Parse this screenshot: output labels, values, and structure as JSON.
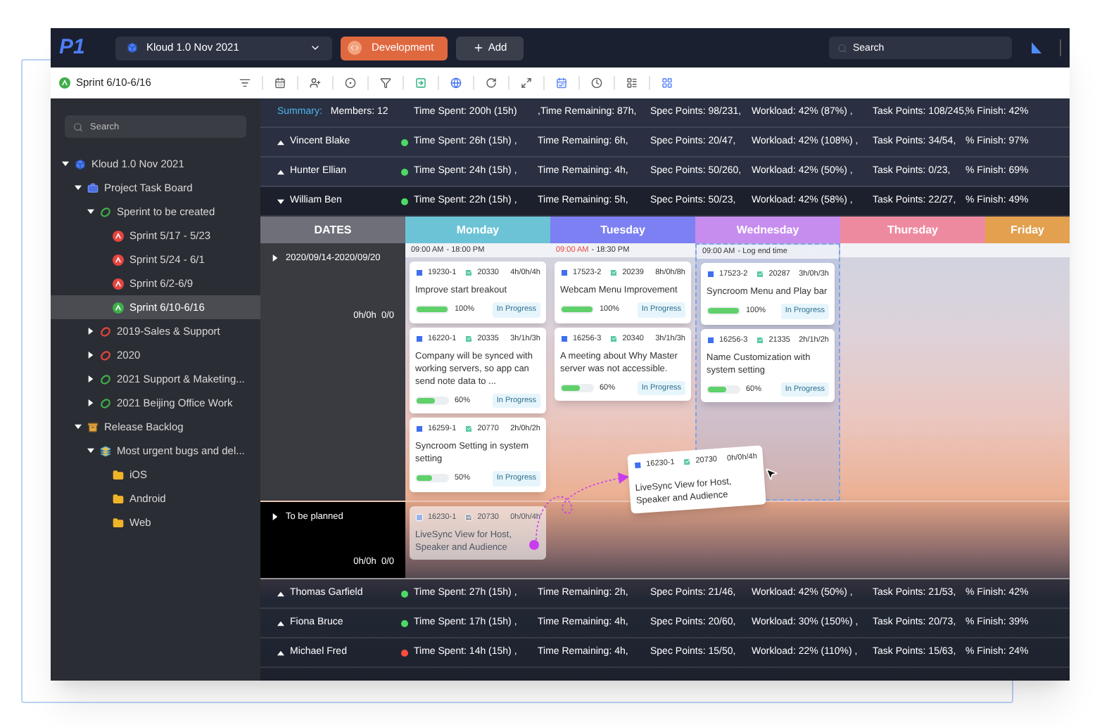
{
  "topbar": {
    "logo": "P1",
    "project": "Kloud 1.0 Nov 2021",
    "mode": "Development",
    "add": "Add",
    "search": {
      "placeholder": "Search"
    }
  },
  "toolbar": {
    "sprint": "Sprint 6/10-6/16"
  },
  "sidebar": {
    "search": {
      "placeholder": "Search"
    },
    "tree": [
      {
        "label": "Kloud 1.0 Nov 2021",
        "kind": "project",
        "expanded": true,
        "selected": false,
        "children": [
          {
            "label": "Project Task Board",
            "kind": "board",
            "expanded": true,
            "selected": false,
            "children": [
              {
                "label": "Sperint to be created",
                "kind": "sprint-group",
                "color": "#3fae49",
                "expanded": true,
                "selected": false,
                "children": [
                  {
                    "label": "Sprint 5/17 - 5/23",
                    "kind": "sprint",
                    "color": "#e5453f",
                    "selected": false
                  },
                  {
                    "label": "Sprint 5/24 - 6/1",
                    "kind": "sprint",
                    "color": "#e5453f",
                    "selected": false
                  },
                  {
                    "label": "Sprint 6/2-6/9",
                    "kind": "sprint",
                    "color": "#e5453f",
                    "selected": false
                  },
                  {
                    "label": "Sprint 6/10-6/16",
                    "kind": "sprint",
                    "color": "#3fae49",
                    "selected": true
                  }
                ]
              },
              {
                "label": "2019-Sales & Support",
                "kind": "sprint-group",
                "color": "#e5453f",
                "expanded": false,
                "selected": false
              },
              {
                "label": "2020",
                "kind": "sprint-group",
                "color": "#e5453f",
                "expanded": false,
                "selected": false
              },
              {
                "label": "2021 Support & Maketing...",
                "kind": "sprint-group",
                "color": "#3fae49",
                "expanded": false,
                "selected": false
              },
              {
                "label": "2021 Beijing Office Work",
                "kind": "sprint-group",
                "color": "#3fae49",
                "expanded": false,
                "selected": false
              }
            ]
          },
          {
            "label": "Release Backlog",
            "kind": "backlog",
            "expanded": true,
            "selected": false,
            "children": [
              {
                "label": "Most urgent bugs and del...",
                "kind": "stack",
                "expanded": true,
                "selected": false,
                "children": [
                  {
                    "label": "iOS",
                    "kind": "folder",
                    "selected": false
                  },
                  {
                    "label": "Android",
                    "kind": "folder",
                    "selected": false
                  },
                  {
                    "label": "Web",
                    "kind": "folder",
                    "selected": false
                  }
                ]
              }
            ]
          }
        ]
      }
    ]
  },
  "summary": {
    "label": "Summary:",
    "members": "Members: 12",
    "stats": [
      "Time Spent: 200h (15h)",
      ",Time Remaining: 87h,",
      "Spec Points: 98/231,",
      "Workload: 42% (87%) ,",
      "Task Points: 108/245,",
      "% Finish: 42%"
    ]
  },
  "members_top": [
    {
      "name": "Vincent Blake",
      "expanded": false,
      "color": "#4cd964",
      "stats": [
        "Time Spent: 26h (15h) ,",
        "Time Remaining: 6h,",
        "Spec Points: 20/47,",
        "Workload: 42% (108%) ,",
        "Task Points: 34/54,",
        "% Finish: 97%"
      ]
    },
    {
      "name": "Hunter Ellian",
      "expanded": false,
      "color": "#4cd964",
      "stats": [
        "Time Spent: 24h (15h) ,",
        "Time Remaining: 4h,",
        "Spec Points: 50/260,",
        "Workload: 42% (50%) ,",
        "Task Points: 0/23,",
        "% Finish: 69%"
      ]
    },
    {
      "name": "William Ben",
      "expanded": true,
      "color": "#4cd964",
      "stats": [
        "Time Spent: 22h (15h) ,",
        "Time Remaining: 5h,",
        "Spec Points: 50/23,",
        "Workload: 42% (58%) ,",
        "Task Points: 22/27,",
        "% Finish: 49%"
      ]
    }
  ],
  "board": {
    "columns": [
      {
        "label": "DATES",
        "color": "#6e6f78"
      },
      {
        "label": "Monday",
        "color": "#6cc3d6"
      },
      {
        "label": "Tuesday",
        "color": "#7c80f2"
      },
      {
        "label": "Wednesday",
        "color": "#c68cee"
      },
      {
        "label": "Thursday",
        "color": "#ee8aa0"
      },
      {
        "label": "Friday",
        "color": "#e3a04e"
      }
    ],
    "groups": [
      {
        "label": "2020/09/14-2020/09/20",
        "totals": "0h/0h  0/0",
        "dark": false,
        "days": [
          {
            "time": {
              "start": "09:00 AM",
              "end": "- 18:00 PM",
              "late": false
            },
            "drop_target": false,
            "cards": [
              {
                "id": "19230-1",
                "task": "20330",
                "time": "4h/0h/4h",
                "title": "Improve start breakout",
                "level": 1,
                "percent": "100%",
                "status": "In Progress"
              },
              {
                "id": "16220-1",
                "task": "20335",
                "time": "3h/1h/3h",
                "title": "Company will be synced with working servers, so app can send note data to ...",
                "level": 0.6,
                "percent": "60%",
                "status": "In Progress"
              },
              {
                "id": "16259-1",
                "task": "20770",
                "time": "2h/0h/2h",
                "title": "Syncroom Setting in system setting",
                "level": 0.5,
                "percent": "50%",
                "status": "In Progress"
              }
            ]
          },
          {
            "time": {
              "start": "09:00 AM",
              "end": "- 18:30 PM",
              "late": true
            },
            "drop_target": false,
            "cards": [
              {
                "id": "17523-2",
                "task": "20239",
                "time": "8h/0h/8h",
                "title": "Webcam Menu Improvement",
                "level": 1,
                "percent": "100%",
                "status": "In Progress"
              },
              {
                "id": "16256-3",
                "task": "20340",
                "time": "3h/1h/3h",
                "title": "A meeting  about Why  Master server was not accessible.",
                "level": 0.6,
                "percent": "60%",
                "status": "In Progress"
              }
            ]
          },
          {
            "time": {
              "start": "09:00 AM",
              "end": "- Log end time",
              "late": false
            },
            "drop_target": true,
            "cards": [
              {
                "id": "17523-2",
                "task": "20287",
                "time": "3h/0h/3h",
                "title": "Syncroom Menu and Play bar",
                "level": 1,
                "percent": "100%",
                "status": "In Progress"
              },
              {
                "id": "16256-3",
                "task": "21335",
                "time": "2h/1h/2h",
                "title": "Name Customization with system setting",
                "level": 0.6,
                "percent": "60%",
                "status": "In Progress"
              }
            ]
          }
        ]
      },
      {
        "label": "To be planned",
        "totals": "0h/0h  0/0",
        "dark": true,
        "days": [
          {
            "cards": [
              {
                "id": "16230-1",
                "task": "20730",
                "time": "0h/0h/4h",
                "title": "LiveSync View for Host, Speaker and Audience",
                "ghost": true
              }
            ]
          }
        ]
      }
    ],
    "drag_preview": {
      "id": "16230-1",
      "task": "20730",
      "time": "0h/0h/4h",
      "title": "LiveSync View for Host, Speaker and Audience"
    }
  },
  "members_bottom": [
    {
      "name": "Thomas Garfield",
      "expanded": false,
      "color": "#4cd964",
      "stats": [
        "Time Spent: 27h (15h) ,",
        "Time Remaining: 2h,",
        "Spec Points: 21/46,",
        "Workload: 42% (50%) ,",
        "Task Points: 21/53,",
        "% Finish: 42%"
      ]
    },
    {
      "name": "Fiona Bruce",
      "expanded": false,
      "color": "#4cd964",
      "stats": [
        "Time Spent: 17h (15h) ,",
        "Time Remaining: 4h,",
        "Spec Points: 20/60,",
        "Workload: 30% (150%) ,",
        "Task Points: 20/73,",
        "% Finish: 39%"
      ]
    },
    {
      "name": "Michael Fred",
      "expanded": false,
      "color": "#ff4d3d",
      "stats": [
        "Time Spent: 14h (15h) ,",
        "Time Remaining: 4h,",
        "Spec Points: 15/50,",
        "Workload: 22% (110%) ,",
        "Task Points: 15/63,",
        "% Finish: 24%"
      ]
    }
  ]
}
